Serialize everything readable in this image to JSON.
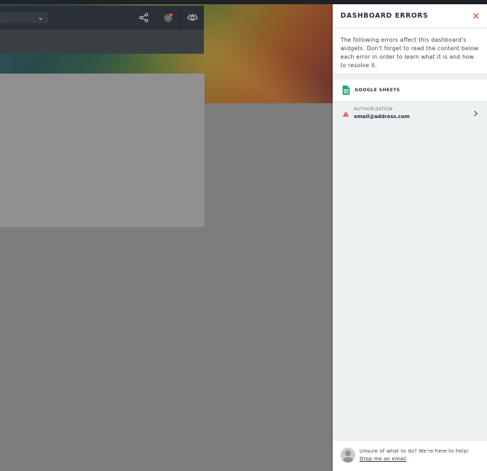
{
  "panel": {
    "title": "DASHBOARD ERRORS",
    "intro": "The following errors affect this dashboard's widgets. Don't forget to read the content below each error in order to learn what it is and how to resolve it.",
    "source": {
      "label": "GOOGLE SHEETS",
      "icon": "google-sheets-icon"
    },
    "errors": [
      {
        "type": "AUTHORIZATION",
        "account": "email@address.com"
      }
    ],
    "help": {
      "text": "Unsure of what to do? We're here to help!",
      "link": "Drop me an email"
    }
  },
  "toolbar": {
    "icons": [
      "share-icon",
      "settings-icon",
      "view-icon"
    ]
  },
  "colors": {
    "close": "#e0504d",
    "warning": "#d9534f",
    "sheets": "#23a566",
    "toolbar": "#2a3036",
    "notification": "#e0504d"
  }
}
